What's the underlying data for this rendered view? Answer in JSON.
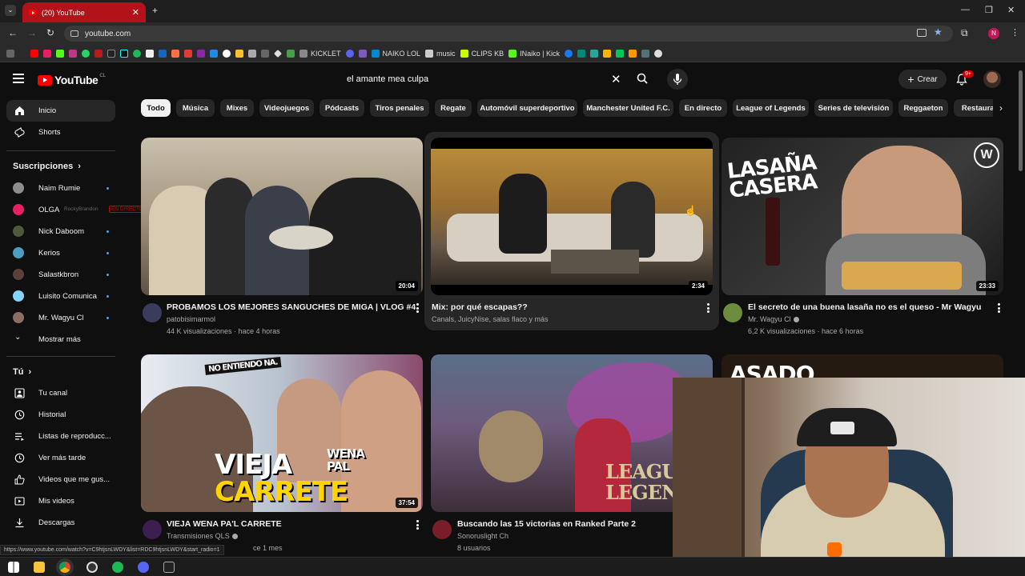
{
  "browser": {
    "tab_title": "(20) YouTube",
    "url": "youtube.com",
    "status_url": "https://www.youtube.com/watch?v=C9htjsnLWDY&list=RDC9htjsnLWDY&start_radio=1",
    "bookmarks": [
      "KICKLET",
      "NAIKO LOL",
      "music",
      "CLIPS KB",
      "INaiko | Kick"
    ]
  },
  "header": {
    "logo_text": "YouTube",
    "country_code": "CL",
    "search_value": "el amante mea culpa",
    "create_label": "Crear",
    "notif_count": "9+"
  },
  "sidebar": {
    "main": [
      {
        "label": "Inicio"
      },
      {
        "label": "Shorts"
      }
    ],
    "subs_heading": "Suscripciones",
    "subs": [
      {
        "label": "Naim Rumie"
      },
      {
        "label": "OLGA",
        "live": "EN DIRECTO",
        "ghost": "RockyBrandon"
      },
      {
        "label": "Nick Daboom"
      },
      {
        "label": "Kerios"
      },
      {
        "label": "Salastkbron"
      },
      {
        "label": "Luisito Comunica"
      },
      {
        "label": "Mr. Wagyu Cl"
      }
    ],
    "show_more": "Mostrar más",
    "you_heading": "Tú",
    "you": [
      {
        "label": "Tu canal"
      },
      {
        "label": "Historial"
      },
      {
        "label": "Listas de reproducc..."
      },
      {
        "label": "Ver más tarde"
      },
      {
        "label": "Videos que me gus..."
      },
      {
        "label": "Mis videos"
      },
      {
        "label": "Descargas"
      }
    ]
  },
  "chips": [
    "Todo",
    "Música",
    "Mixes",
    "Videojuegos",
    "Pódcasts",
    "Tiros penales",
    "Regate",
    "Automóvil superdeportivo",
    "Manchester United F.C.",
    "En directo",
    "League of Legends",
    "Series de televisión",
    "Reggaeton",
    "Restaurantes"
  ],
  "videos": [
    {
      "title": "PROBAMOS LOS MEJORES SANGUCHES DE MIGA | VLOG #4",
      "channel": "patobisimarmol",
      "meta": "44 K visualizaciones · hace 4 horas",
      "duration": "20:04"
    },
    {
      "title": "Mix: por qué escapas??",
      "channel": "Canals, JuicyNise, salas flaco y más",
      "meta": "",
      "duration": "2:34"
    },
    {
      "title": "El secreto de una buena lasaña no es el queso - Mr Wagyu",
      "channel": "Mr. Wagyu Cl",
      "meta": "6,2 K visualizaciones · hace 6 horas",
      "duration": "23:33",
      "overlay": "LASAÑA CASERA",
      "badge": "W"
    },
    {
      "title": "VIEJA WENA PA'L CARRETE",
      "channel": "Transmisiones QLS",
      "meta": "ce 1 mes",
      "duration": "37:54",
      "overlay1": "VIEJA",
      "overlay2": "WENA PAL",
      "overlay3": "CARRETE",
      "overlay_top": "NO ENTIENDO NA."
    },
    {
      "title": "Buscando las 15 victorias en Ranked Parte 2",
      "channel": "Sonoruslight Ch",
      "meta": "8 usuarios",
      "overlay1": "LEAGU",
      "overlay2": "LEGEN"
    },
    {
      "overlay": "ASADO"
    }
  ]
}
